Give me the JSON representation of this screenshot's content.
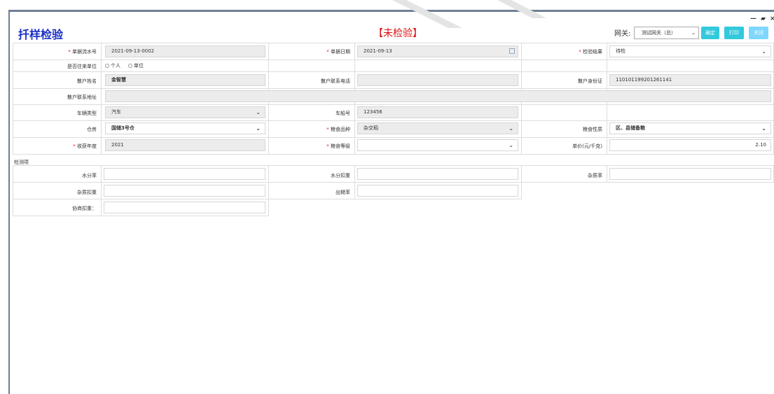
{
  "title": "扦样检验",
  "status": "【未检验】",
  "gateway": {
    "label": "网关:",
    "value": "测试网关（总）"
  },
  "buttons": {
    "confirm": "确定",
    "print": "打印",
    "close": "关闭"
  },
  "window_controls": {
    "minimize": "—",
    "restore": "▰",
    "close": "×"
  },
  "form": {
    "doc_no_label": "单据流水号",
    "doc_no": "2021-09-13-0002",
    "doc_date_label": "单据日期",
    "doc_date": "2021-09-13",
    "result_label": "检验结果",
    "result": "待检",
    "is_unit_label": "是否往来单位",
    "radio_personal": "个人",
    "radio_unit": "单位",
    "farmer_name_label": "散户姓名",
    "farmer_name": "金智慧",
    "farmer_phone_label": "散户联系电话",
    "farmer_phone": "",
    "farmer_id_label": "散户身份证",
    "farmer_id": "110101199201261141",
    "farmer_address_label": "散户联系地址",
    "farmer_address": "",
    "vehicle_type_label": "车辆类型",
    "vehicle_type": "汽车",
    "plate_label": "车船号",
    "plate": "123456",
    "warehouse_label": "仓房",
    "warehouse": "国储3号仓",
    "grain_type_label": "粮食品种",
    "grain_type": "杂交稻",
    "grain_nature_label": "粮食性质",
    "grain_nature": "区、县储备粮",
    "harvest_year_label": "收获年度",
    "harvest_year": "2021",
    "grain_grade_label": "粮食等级",
    "grain_grade": "",
    "price_label": "单价(元/千克)",
    "price": "2.10"
  },
  "inspection": {
    "section_label": "检测项",
    "moisture_label": "水分率",
    "moisture_deduct_label": "水分扣重",
    "impurity_label": "杂质率",
    "impurity_deduct_label": "杂质扣重",
    "yield_label": "出糙率",
    "agreed_deduct_label": "协商扣重："
  }
}
